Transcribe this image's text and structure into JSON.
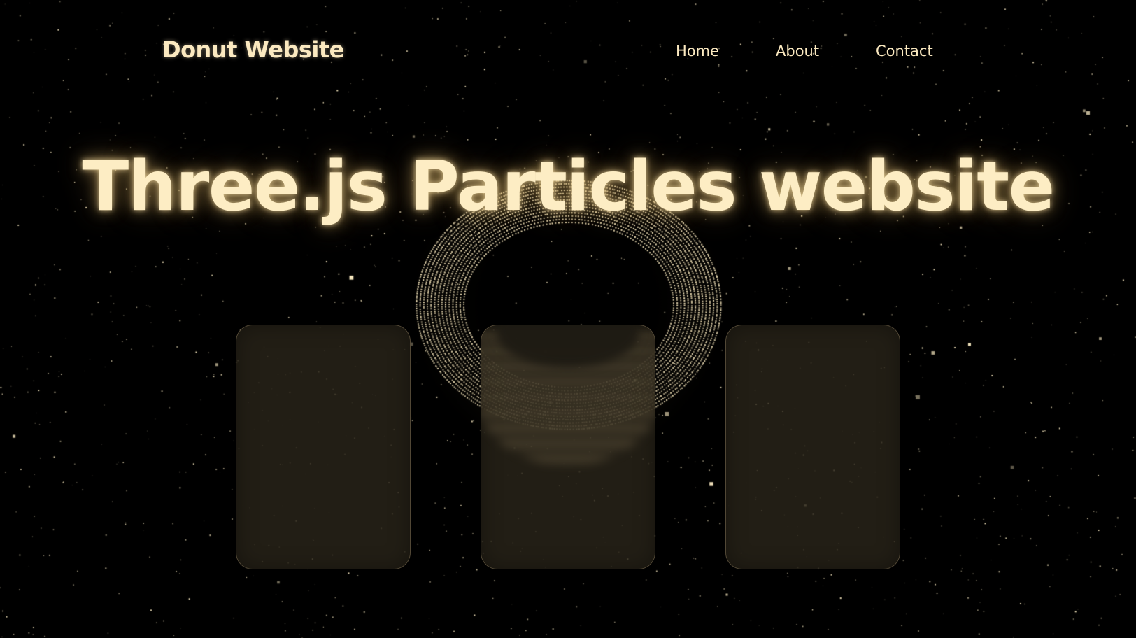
{
  "header": {
    "logo": "Donut Website",
    "nav": [
      {
        "label": "Home"
      },
      {
        "label": "About"
      },
      {
        "label": "Contact"
      }
    ]
  },
  "hero": {
    "title": "Three.js Particles website"
  },
  "cards": [
    {
      "id": "card-1"
    },
    {
      "id": "card-2"
    },
    {
      "id": "card-3"
    }
  ],
  "colors": {
    "background": "#000000",
    "accent": "#fbe9c0",
    "card": "#2a241a"
  }
}
